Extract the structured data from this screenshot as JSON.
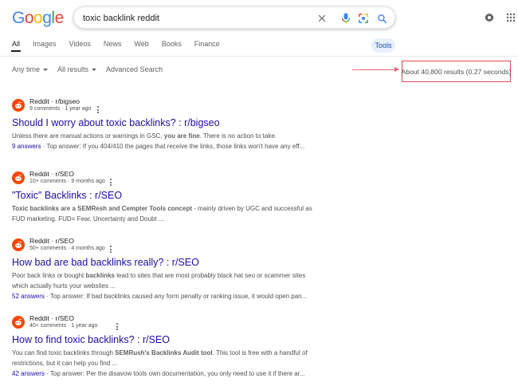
{
  "search": {
    "query": "toxic backlink reddit"
  },
  "logo": {
    "letters": [
      "G",
      "o",
      "o",
      "g",
      "l",
      "e"
    ],
    "colors": [
      "#4285f4",
      "#ea4335",
      "#fbbc05",
      "#4285f4",
      "#34a853",
      "#ea4335"
    ]
  },
  "tabs": [
    {
      "label": "All",
      "active": true
    },
    {
      "label": "Images"
    },
    {
      "label": "Videos"
    },
    {
      "label": "News"
    },
    {
      "label": "Web"
    },
    {
      "label": "Books"
    },
    {
      "label": "Finance"
    }
  ],
  "tools_label": "Tools",
  "filters": {
    "time": "Any time",
    "results": "All results",
    "advanced": "Advanced Search"
  },
  "result_stats": "About 40,800 results (0.27 seconds)",
  "results": [
    {
      "site": "Reddit · r/bigseo",
      "meta": "9 comments · 1 year ago",
      "title": "Should I worry about toxic backlinks? : r/bigseo",
      "snippet_parts": [
        {
          "t": "Unless there are manual actions or warnings in GSC, "
        },
        {
          "t": "you are fine",
          "b": true
        },
        {
          "t": ". There is no action to take."
        }
      ],
      "answers": "9 answers",
      "answer_text": " · Top answer: If you 404/410 the pages that receive the links, those links won't have any eff..."
    },
    {
      "site": "Reddit · r/SEO",
      "meta": "10+ comments · 9 months ago",
      "title": "\"Toxic\" Backlinks : r/SEO",
      "snippet_parts": [
        {
          "t": "Toxic backlinks are a SEMResh and Cempter Tools concept",
          "b": true
        },
        {
          "t": " - mainly driven by UGC and successful as FUD marketing. FUD= Fear, Uncertainty and Doubt ..."
        }
      ]
    },
    {
      "site": "Reddit · r/SEO",
      "meta": "50+ comments · 4 months ago",
      "title": "How bad are bad backlinks really? : r/SEO",
      "snippet_parts": [
        {
          "t": "Poor back links or bought "
        },
        {
          "t": "backlinks",
          "b": true
        },
        {
          "t": " lead to sites that are most probably black hat seo or scammer sites which actually hurts your websites ..."
        }
      ],
      "answers": "52 answers",
      "answer_text": " · Top answer: If bad backlinks caused any form penalty or ranking issue, it would open pan..."
    },
    {
      "site": "Reddit · r/SEO",
      "meta": "40+ comments · 1 year ago",
      "title": "How to find toxic backlinks? : r/SEO",
      "snippet_parts": [
        {
          "t": "You can find toxic backlinks through "
        },
        {
          "t": "SEMRush's Backlinks Audit tool",
          "b": true
        },
        {
          "t": ". This tool is free with a handful of restrictions, but it can help you find ..."
        }
      ],
      "answers": "42 answers",
      "answer_text": " · Top answer: Per the disavow tools own documentation, you only need to use it if there ar..."
    }
  ]
}
